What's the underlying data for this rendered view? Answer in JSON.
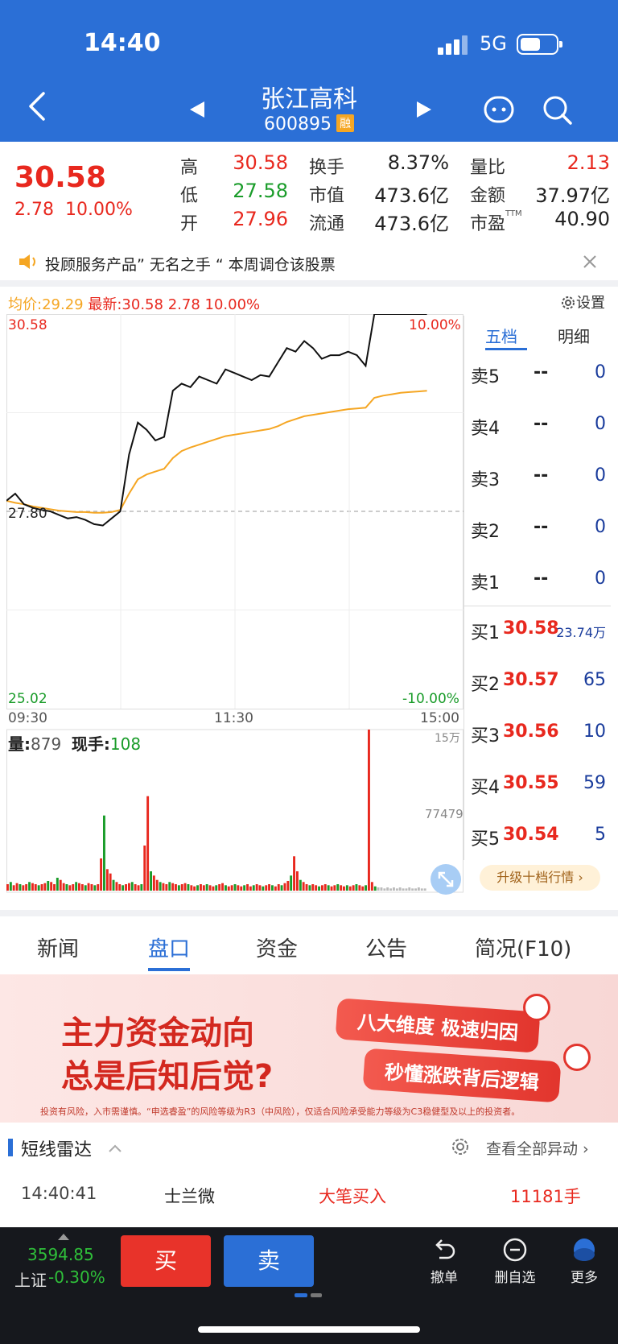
{
  "status": {
    "time": "14:40",
    "network": "5G"
  },
  "header": {
    "name": "张江高科",
    "code": "600895",
    "margin_badge": "融"
  },
  "quote": {
    "price": "30.58",
    "change": "2.78",
    "change_pct": "10.00%",
    "stats": [
      {
        "label": "高",
        "value": "30.58",
        "color": "red"
      },
      {
        "label": "低",
        "value": "27.58",
        "color": "green"
      },
      {
        "label": "开",
        "value": "27.96",
        "color": "red"
      },
      {
        "label": "换手",
        "value": "8.37%"
      },
      {
        "label": "市值",
        "value": "473.6亿"
      },
      {
        "label": "流通",
        "value": "473.6亿"
      },
      {
        "label": "量比",
        "value": "2.13",
        "color": "red"
      },
      {
        "label": "金额",
        "value": "37.97亿"
      },
      {
        "label": "市盈",
        "value": "40.90",
        "superscript": "TTM"
      }
    ]
  },
  "notice": {
    "text": "投顾服务产品” 无名之手 “ 本周调仓该股票"
  },
  "chart_info": {
    "avg_label": "均价:",
    "avg_value": "29.29",
    "last_label": "最新:",
    "last_value": "30.58",
    "last_change": "2.78",
    "last_pct": "10.00%",
    "settings": "设置"
  },
  "chart_data": {
    "type": "line",
    "price_axis": {
      "max": "30.58",
      "prev_close": "27.80",
      "min": "25.02",
      "max_pct": "10.00%",
      "min_pct": "-10.00%"
    },
    "time_labels": [
      "09:30",
      "11:30",
      "15:00"
    ],
    "series": [
      {
        "values": [
          27.95,
          28.05,
          27.9,
          27.85,
          27.82,
          27.8,
          27.75,
          27.7,
          27.72,
          27.68,
          27.62,
          27.6,
          27.7,
          27.8,
          28.6,
          29.05,
          28.95,
          28.8,
          28.85,
          29.5,
          29.6,
          29.55,
          29.7,
          29.65,
          29.6,
          29.8,
          29.75,
          29.7,
          29.65,
          29.72,
          29.7,
          29.9,
          30.1,
          30.05,
          30.2,
          30.1,
          29.95,
          30.0,
          30.0,
          30.05,
          30.0,
          29.85,
          30.58,
          30.58,
          30.58,
          30.58,
          30.58,
          30.58,
          30.58
        ]
      },
      {
        "values": [
          27.95,
          27.92,
          27.9,
          27.87,
          27.85,
          27.83,
          27.81,
          27.8,
          27.79,
          27.79,
          27.78,
          27.78,
          27.79,
          27.82,
          28.05,
          28.25,
          28.32,
          28.36,
          28.4,
          28.55,
          28.65,
          28.7,
          28.74,
          28.78,
          28.82,
          28.86,
          28.88,
          28.9,
          28.92,
          28.94,
          28.96,
          29.0,
          29.06,
          29.1,
          29.14,
          29.16,
          29.18,
          29.2,
          29.22,
          29.24,
          29.25,
          29.26,
          29.4,
          29.43,
          29.45,
          29.47,
          29.48,
          29.49,
          29.5
        ]
      }
    ],
    "volume": {
      "label": "量:",
      "value": "879",
      "hand_label": "现手:",
      "hand_value": "108",
      "max_label": "15万",
      "mid_label": "77479",
      "values": [
        6,
        8,
        5,
        7,
        6,
        5,
        6,
        8,
        7,
        6,
        5,
        6,
        7,
        9,
        8,
        6,
        12,
        10,
        7,
        6,
        5,
        6,
        8,
        7,
        6,
        5,
        7,
        6,
        5,
        6,
        30,
        70,
        20,
        16,
        10,
        8,
        6,
        5,
        6,
        7,
        8,
        6,
        5,
        6,
        42,
        88,
        18,
        14,
        10,
        8,
        7,
        6,
        8,
        7,
        6,
        5,
        6,
        7,
        6,
        5,
        4,
        5,
        6,
        5,
        6,
        5,
        4,
        5,
        6,
        7,
        5,
        4,
        5,
        6,
        5,
        4,
        5,
        6,
        4,
        5,
        6,
        5,
        4,
        5,
        6,
        5,
        4,
        6,
        5,
        7,
        9,
        14,
        32,
        18,
        10,
        8,
        6,
        5,
        6,
        5,
        4,
        5,
        6,
        5,
        4,
        5,
        6,
        5,
        4,
        5,
        4,
        5,
        6,
        5,
        4,
        5,
        150,
        8,
        4,
        3,
        3,
        2,
        3,
        2,
        3,
        2,
        3,
        2,
        2,
        3,
        2,
        2,
        3,
        2,
        2
      ]
    }
  },
  "order_book": {
    "tabs": [
      "五档",
      "明细"
    ],
    "asks": [
      {
        "label": "卖5",
        "price": "--",
        "volume": "0"
      },
      {
        "label": "卖4",
        "price": "--",
        "volume": "0"
      },
      {
        "label": "卖3",
        "price": "--",
        "volume": "0"
      },
      {
        "label": "卖2",
        "price": "--",
        "volume": "0"
      },
      {
        "label": "卖1",
        "price": "--",
        "volume": "0"
      }
    ],
    "bids": [
      {
        "label": "买1",
        "price": "30.58",
        "volume": "23.74万"
      },
      {
        "label": "买2",
        "price": "30.57",
        "volume": "65"
      },
      {
        "label": "买3",
        "price": "30.56",
        "volume": "10"
      },
      {
        "label": "买4",
        "price": "30.55",
        "volume": "59"
      },
      {
        "label": "买5",
        "price": "30.54",
        "volume": "5"
      }
    ],
    "upgrade": "升级十档行情"
  },
  "tabs": [
    "新闻",
    "盘口",
    "资金",
    "公告",
    "简况(F10)"
  ],
  "banner": {
    "line1": "主力资金动向",
    "line2": "总是后知后觉?",
    "pill1": "八大维度  极速归因",
    "pill2": "秒懂涨跌背后逻辑",
    "fine": "投资有风险，入市需谨慎。“申选睿盈”的风险等级为R3（中风险），仅适合风险承受能力等级为C3稳健型及以上的投资者。"
  },
  "radar": {
    "title": "短线雷达",
    "view_all": "查看全部异动",
    "rows": [
      {
        "time": "14:40:41",
        "name": "士兰微",
        "type": "大笔买入",
        "volume": "11181手"
      }
    ]
  },
  "bottom": {
    "index_value": "3594.85",
    "index_name": "上证",
    "index_change": "-0.30%",
    "buy": "买",
    "sell": "卖",
    "actions": [
      "撤单",
      "删自选",
      "更多"
    ]
  },
  "colors": {
    "brand": "#2b6fd6",
    "up": "#e8281e",
    "down": "#1a9c2a",
    "avg_line": "#f5a623"
  }
}
